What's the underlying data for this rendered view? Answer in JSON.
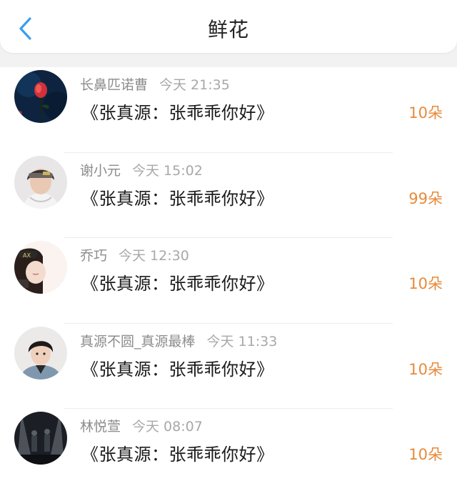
{
  "header": {
    "title": "鲜花",
    "back_icon": "chevron-left-icon",
    "accent_color": "#3a9ef0"
  },
  "flowers": [
    {
      "name": "长鼻匹诺曹",
      "time": "今天 21:35",
      "message": "《张真源：张乖乖你好》",
      "count": "10朵",
      "avatar": "rose-avatar"
    },
    {
      "name": "谢小元",
      "time": "今天 15:02",
      "message": "《张真源：张乖乖你好》",
      "count": "99朵",
      "avatar": "boy-headband-avatar"
    },
    {
      "name": "乔巧",
      "time": "今天 12:30",
      "message": "《张真源：张乖乖你好》",
      "count": "10朵",
      "avatar": "girl-cap-avatar"
    },
    {
      "name": "真源不圆_真源最棒",
      "time": "今天 11:33",
      "message": "《张真源：张乖乖你好》",
      "count": "10朵",
      "avatar": "boy-portrait-avatar"
    },
    {
      "name": "林悦萱",
      "time": "今天 08:07",
      "message": "《张真源：张乖乖你好》",
      "count": "10朵",
      "avatar": "stage-avatar"
    }
  ],
  "colors": {
    "count": "#e88a3a",
    "name": "#8c8c8c",
    "message": "#1a1a1a"
  }
}
